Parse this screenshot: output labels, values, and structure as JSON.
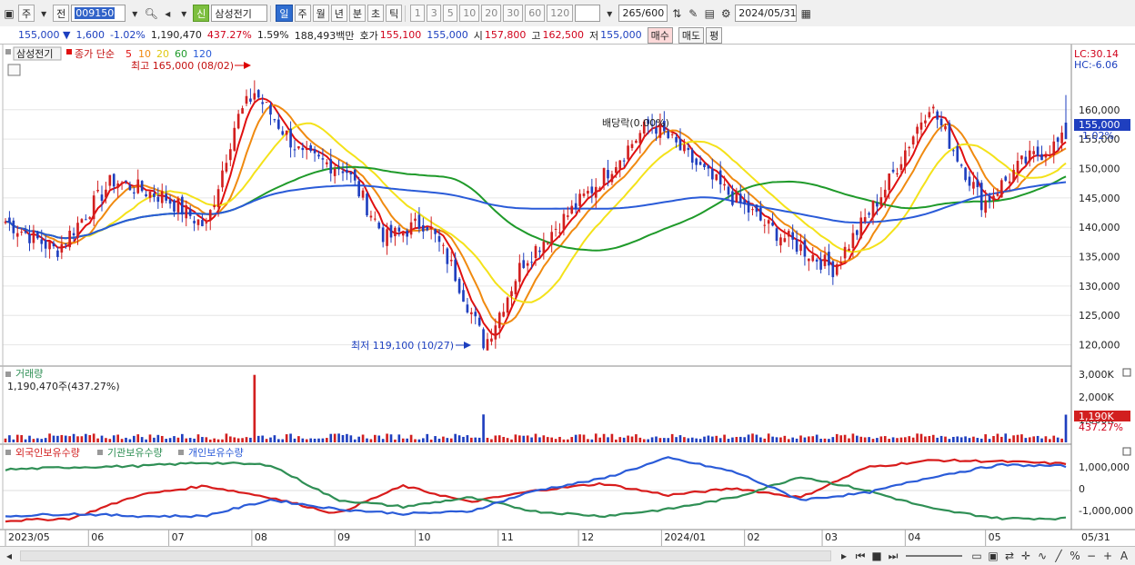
{
  "toolbar": {
    "period_mode": "주",
    "prev_label": "전",
    "stock_code": "009150",
    "stock_name": "삼성전기",
    "new_badge": "신",
    "periods": [
      "일",
      "주",
      "월",
      "년",
      "분",
      "초",
      "틱"
    ],
    "active_period": "일",
    "intervals": [
      "1",
      "3",
      "5",
      "10",
      "20",
      "30",
      "60",
      "120"
    ],
    "count": "265",
    "count_total": "/600",
    "date": "2024/05/31"
  },
  "info": {
    "price": "155,000 ▼",
    "change": "1,600",
    "change_pct": "-1.02%",
    "volume": "1,190,470",
    "volume_ratio": "437.27%",
    "turnover": "1.59%",
    "amount": "188,493백만",
    "quote_label": "호가",
    "quote1": "155,100",
    "quote2": "155,000",
    "open_label": "시",
    "open": "157,800",
    "high_label": "고",
    "high": "162,500",
    "low_label": "저",
    "low": "155,000",
    "buy": "매수",
    "sell": "매도",
    "eval": "평"
  },
  "legend": {
    "name": "삼성전기",
    "close_simple": "종가 단순",
    "ma": [
      "5",
      "10",
      "20",
      "60",
      "120"
    ],
    "lc": "LC:30.14",
    "hc": "HC:-6.06"
  },
  "annotations": {
    "max": "최고 165,000 (08/02)",
    "min": "최저 119,100 (10/27)",
    "ex_div": "배당락(0.00%)",
    "price_tag": "155,000",
    "price_pct": "-1.02%"
  },
  "volume_panel": {
    "title": "거래량",
    "value": "1,190,470주(437.27%)",
    "axis": [
      "3,000K",
      "2,000K",
      "1,000K"
    ],
    "tag": "1,190K",
    "tag_pct": "437.27%"
  },
  "holdings_panel": {
    "legend": [
      "외국인보유수량",
      "기관보유수량",
      "개인보유수량"
    ],
    "axis": [
      "1,000,000",
      "0",
      "-1,000,000"
    ]
  },
  "price_axis": [
    "160,000",
    "155,000",
    "150,000",
    "145,000",
    "140,000",
    "135,000",
    "130,000",
    "125,000",
    "120,000"
  ],
  "x_axis": [
    "2023/05",
    "06",
    "07",
    "08",
    "09",
    "10",
    "11",
    "12",
    "2024/01",
    "02",
    "03",
    "04",
    "05",
    "05/31"
  ],
  "colors": {
    "up": "#d21f1f",
    "down": "#1f3fbf",
    "ma5": "#e01010",
    "ma10": "#f08a10",
    "ma20": "#f4e21a",
    "ma60": "#1f9a2a",
    "ma120": "#2a5bd8",
    "foreign": "#d81c1c",
    "institution": "#2f8f55",
    "individual": "#2a5bd8"
  },
  "chart_data": {
    "type": "candlestick",
    "title": "삼성전기",
    "x_start": "2023/05",
    "x_end": "2024/05/31",
    "ylim": [
      117000,
      168000
    ],
    "y_ticks": [
      120000,
      125000,
      130000,
      135000,
      140000,
      145000,
      150000,
      155000,
      160000
    ],
    "close_anchors": [
      {
        "date": "2023/05/01",
        "close": 141000
      },
      {
        "date": "2023/05/20",
        "close": 136000
      },
      {
        "date": "2023/06/10",
        "close": 148000
      },
      {
        "date": "2023/06/30",
        "close": 145000
      },
      {
        "date": "2023/07/15",
        "close": 140000
      },
      {
        "date": "2023/07/26",
        "close": 158000
      },
      {
        "date": "2023/08/02",
        "close": 163000
      },
      {
        "date": "2023/08/20",
        "close": 152000
      },
      {
        "date": "2023/09/05",
        "close": 150000
      },
      {
        "date": "2023/09/20",
        "close": 138000
      },
      {
        "date": "2023/10/05",
        "close": 141000
      },
      {
        "date": "2023/10/15",
        "close": 133000
      },
      {
        "date": "2023/10/27",
        "close": 120000
      },
      {
        "date": "2023/11/10",
        "close": 134000
      },
      {
        "date": "2023/12/05",
        "close": 146000
      },
      {
        "date": "2023/12/28",
        "close": 158000
      },
      {
        "date": "2024/01/20",
        "close": 148000
      },
      {
        "date": "2024/02/10",
        "close": 140000
      },
      {
        "date": "2024/03/05",
        "close": 133000
      },
      {
        "date": "2024/03/25",
        "close": 147000
      },
      {
        "date": "2024/04/10",
        "close": 161000
      },
      {
        "date": "2024/04/30",
        "close": 144000
      },
      {
        "date": "2024/05/15",
        "close": 151000
      },
      {
        "date": "2024/05/31",
        "close": 155000
      }
    ],
    "max": {
      "date": "2023/08/02",
      "value": 165000
    },
    "min": {
      "date": "2023/10/27",
      "value": 119100
    },
    "last": {
      "close": 155000,
      "open": 157800,
      "high": 162500,
      "low": 155000,
      "volume": 1190470
    },
    "series": [
      {
        "name": "5"
      },
      {
        "name": "10"
      },
      {
        "name": "20"
      },
      {
        "name": "60"
      },
      {
        "name": "120"
      }
    ],
    "volume_ylim": [
      0,
      3200000
    ],
    "holdings_series": [
      {
        "name": "외국인보유수량",
        "values": [
          -1300000,
          -1200000,
          -200000,
          200000,
          -300000,
          -1000000,
          200000,
          -500000,
          0,
          300000,
          -200000,
          100000,
          -300000,
          1000000,
          1300000,
          1250000,
          1150000
        ]
      },
      {
        "name": "기관보유수량",
        "values": [
          900000,
          1000000,
          1050000,
          1200000,
          1100000,
          -400000,
          -700000,
          -300000,
          -900000,
          -1100000,
          -800000,
          -300000,
          600000,
          0,
          -800000,
          -1200000,
          -1200000
        ]
      },
      {
        "name": "개인보유수량",
        "values": [
          -1100000,
          -1000000,
          -1100000,
          -1100000,
          -400000,
          -800000,
          -1000000,
          -900000,
          0,
          500000,
          1400000,
          800000,
          -400000,
          -100000,
          600000,
          1100000,
          1050000
        ]
      }
    ],
    "holdings_ylim": [
      -1600000,
      1600000
    ]
  }
}
